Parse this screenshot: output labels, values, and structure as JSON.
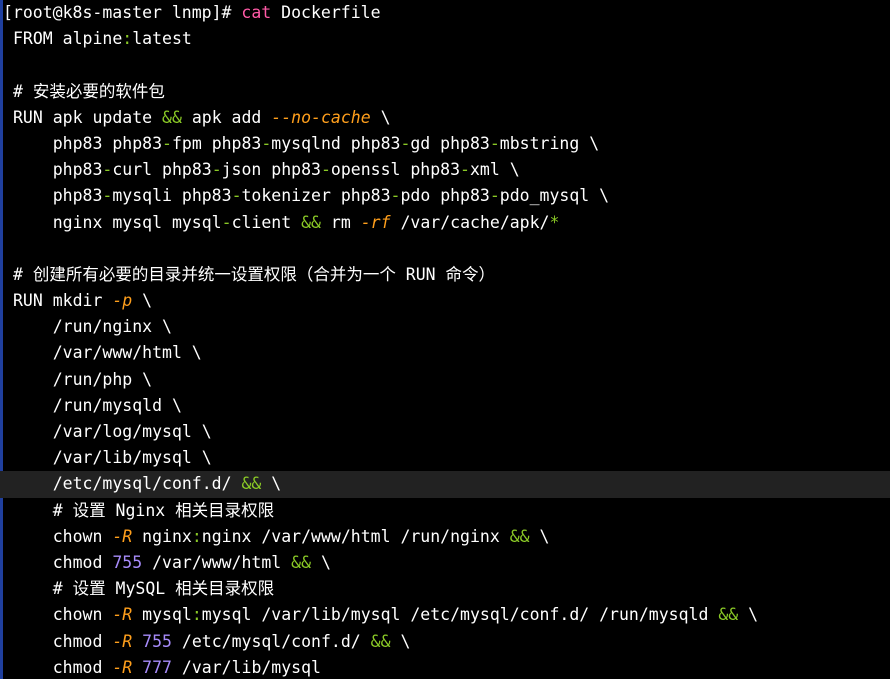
{
  "colors": {
    "background": "#000000",
    "text": "#ffffff",
    "operator": "#8ac926",
    "prompt_cmd": "#ff5aa6",
    "flag": "#ff9f1c",
    "number": "#a78bfa",
    "highlight_row": "#222222"
  },
  "terminal": {
    "highlighted_line_index": 18,
    "lines": [
      [
        {
          "t": "[root@k8s-master lnmp]# ",
          "c": "text"
        },
        {
          "t": "cat",
          "c": "prompt_cmd"
        },
        {
          "t": " Dockerfile",
          "c": "text"
        }
      ],
      [
        {
          "t": "FROM alpine",
          "c": "text"
        },
        {
          "t": ":",
          "c": "operator"
        },
        {
          "t": "latest",
          "c": "text"
        }
      ],
      [],
      [
        {
          "t": "# 安装必要的软件包",
          "c": "text"
        }
      ],
      [
        {
          "t": "RUN apk update ",
          "c": "text"
        },
        {
          "t": "&&",
          "c": "operator"
        },
        {
          "t": " apk add ",
          "c": "text"
        },
        {
          "t": "--no-cache",
          "c": "flag",
          "i": true
        },
        {
          "t": " \\",
          "c": "text"
        }
      ],
      [
        {
          "t": "    php83 php83",
          "c": "text"
        },
        {
          "t": "-",
          "c": "operator"
        },
        {
          "t": "fpm php83",
          "c": "text"
        },
        {
          "t": "-",
          "c": "operator"
        },
        {
          "t": "mysqlnd php83",
          "c": "text"
        },
        {
          "t": "-",
          "c": "operator"
        },
        {
          "t": "gd php83",
          "c": "text"
        },
        {
          "t": "-",
          "c": "operator"
        },
        {
          "t": "mbstring \\",
          "c": "text"
        }
      ],
      [
        {
          "t": "    php83",
          "c": "text"
        },
        {
          "t": "-",
          "c": "operator"
        },
        {
          "t": "curl php83",
          "c": "text"
        },
        {
          "t": "-",
          "c": "operator"
        },
        {
          "t": "json php83",
          "c": "text"
        },
        {
          "t": "-",
          "c": "operator"
        },
        {
          "t": "openssl php83",
          "c": "text"
        },
        {
          "t": "-",
          "c": "operator"
        },
        {
          "t": "xml \\",
          "c": "text"
        }
      ],
      [
        {
          "t": "    php83",
          "c": "text"
        },
        {
          "t": "-",
          "c": "operator"
        },
        {
          "t": "mysqli php83",
          "c": "text"
        },
        {
          "t": "-",
          "c": "operator"
        },
        {
          "t": "tokenizer php83",
          "c": "text"
        },
        {
          "t": "-",
          "c": "operator"
        },
        {
          "t": "pdo php83",
          "c": "text"
        },
        {
          "t": "-",
          "c": "operator"
        },
        {
          "t": "pdo_mysql \\",
          "c": "text"
        }
      ],
      [
        {
          "t": "    nginx mysql mysql",
          "c": "text"
        },
        {
          "t": "-",
          "c": "operator"
        },
        {
          "t": "client ",
          "c": "text"
        },
        {
          "t": "&&",
          "c": "operator"
        },
        {
          "t": " rm ",
          "c": "text"
        },
        {
          "t": "-rf",
          "c": "flag",
          "i": true
        },
        {
          "t": " /var/cache/apk/",
          "c": "text"
        },
        {
          "t": "*",
          "c": "operator"
        }
      ],
      [],
      [
        {
          "t": "# 创建所有必要的目录并统一设置权限（合并为一个 RUN 命令）",
          "c": "text"
        }
      ],
      [
        {
          "t": "RUN mkdir ",
          "c": "text"
        },
        {
          "t": "-p",
          "c": "flag",
          "i": true
        },
        {
          "t": " \\",
          "c": "text"
        }
      ],
      [
        {
          "t": "    /run/nginx \\",
          "c": "text"
        }
      ],
      [
        {
          "t": "    /var/www/html \\",
          "c": "text"
        }
      ],
      [
        {
          "t": "    /run/php \\",
          "c": "text"
        }
      ],
      [
        {
          "t": "    /run/mysqld \\",
          "c": "text"
        }
      ],
      [
        {
          "t": "    /var/log/mysql \\",
          "c": "text"
        }
      ],
      [
        {
          "t": "    /var/lib/mysql \\",
          "c": "text"
        }
      ],
      [
        {
          "t": "    /etc/mysql/conf.d/ ",
          "c": "text"
        },
        {
          "t": "&&",
          "c": "operator"
        },
        {
          "t": " \\",
          "c": "text"
        }
      ],
      [
        {
          "t": "    # 设置 Nginx 相关目录权限",
          "c": "text"
        }
      ],
      [
        {
          "t": "    chown ",
          "c": "text"
        },
        {
          "t": "-R",
          "c": "flag",
          "i": true
        },
        {
          "t": " nginx",
          "c": "text"
        },
        {
          "t": ":",
          "c": "operator"
        },
        {
          "t": "nginx /var/www/html /run/nginx ",
          "c": "text"
        },
        {
          "t": "&&",
          "c": "operator"
        },
        {
          "t": " \\",
          "c": "text"
        }
      ],
      [
        {
          "t": "    chmod ",
          "c": "text"
        },
        {
          "t": "755",
          "c": "number"
        },
        {
          "t": " /var/www/html ",
          "c": "text"
        },
        {
          "t": "&&",
          "c": "operator"
        },
        {
          "t": " \\",
          "c": "text"
        }
      ],
      [
        {
          "t": "    # 设置 MySQL 相关目录权限",
          "c": "text"
        }
      ],
      [
        {
          "t": "    chown ",
          "c": "text"
        },
        {
          "t": "-R",
          "c": "flag",
          "i": true
        },
        {
          "t": " mysql",
          "c": "text"
        },
        {
          "t": ":",
          "c": "operator"
        },
        {
          "t": "mysql /var/lib/mysql /etc/mysql/conf.d/ /run/mysqld ",
          "c": "text"
        },
        {
          "t": "&&",
          "c": "operator"
        },
        {
          "t": " \\",
          "c": "text"
        }
      ],
      [
        {
          "t": "    chmod ",
          "c": "text"
        },
        {
          "t": "-R",
          "c": "flag",
          "i": true
        },
        {
          "t": " ",
          "c": "text"
        },
        {
          "t": "755",
          "c": "number"
        },
        {
          "t": " /etc/mysql/conf.d/ ",
          "c": "text"
        },
        {
          "t": "&&",
          "c": "operator"
        },
        {
          "t": " \\",
          "c": "text"
        }
      ],
      [
        {
          "t": "    chmod ",
          "c": "text"
        },
        {
          "t": "-R",
          "c": "flag",
          "i": true
        },
        {
          "t": " ",
          "c": "text"
        },
        {
          "t": "777",
          "c": "number"
        },
        {
          "t": " /var/lib/mysql",
          "c": "text"
        }
      ]
    ]
  }
}
